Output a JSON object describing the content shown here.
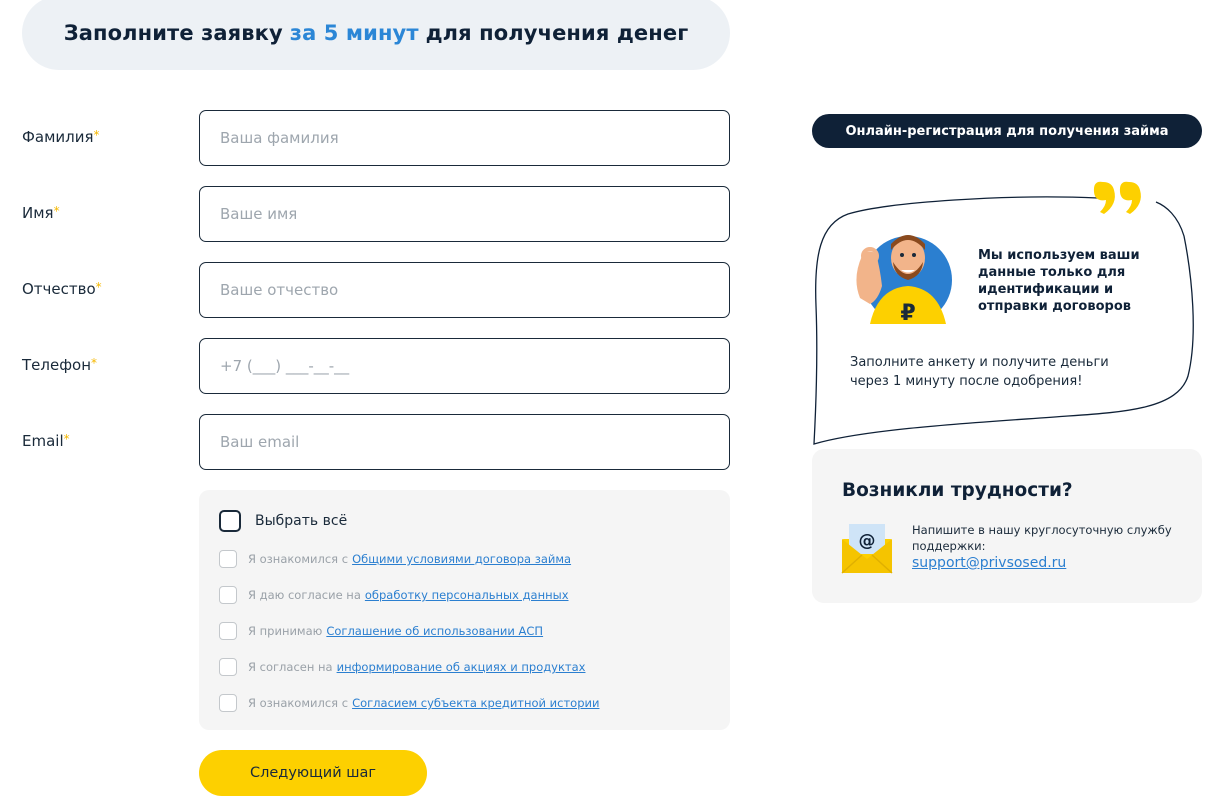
{
  "header": {
    "title_before": "Заполните заявку",
    "title_accent": "за 5 минут",
    "title_after": "для получения денег"
  },
  "form": {
    "fields": [
      {
        "label": "Фамилия",
        "placeholder": "Ваша фамилия"
      },
      {
        "label": "Имя",
        "placeholder": "Ваше имя"
      },
      {
        "label": "Отчество",
        "placeholder": "Ваше отчество"
      },
      {
        "label": "Телефон",
        "placeholder": "+7 (___) ___-__-__"
      },
      {
        "label": "Email",
        "placeholder": "Ваш email"
      }
    ],
    "required_mark": "*"
  },
  "consents": {
    "select_all_label": "Выбрать всё",
    "items": [
      {
        "text": "Я ознакомился с",
        "link": "Общими условиями договора займа"
      },
      {
        "text": "Я даю согласие на",
        "link": "обработку персональных данных"
      },
      {
        "text": "Я принимаю",
        "link": "Соглашение об использовании АСП"
      },
      {
        "text": "Я согласен на",
        "link": "информирование об акциях и продуктах"
      },
      {
        "text": "Я ознакомился с",
        "link": "Согласием субъекта кредитной истории"
      }
    ]
  },
  "next_button": "Следующий шаг",
  "sidebar": {
    "registration_pill": "Онлайн-регистрация для получения займа",
    "bubble_bold": "Мы используем ваши данные только для идентификации и отправки договоров",
    "bubble_text": "Заполните анкету и получите деньги через 1 минуту после одобрения!",
    "help_title": "Возникли трудности?",
    "help_text": "Напишите в нашу круглосуточную службу поддержки:",
    "help_email": "support@privsosed.ru"
  },
  "colors": {
    "accent_blue": "#2b86d6",
    "navy": "#0f2137",
    "yellow": "#fdd000",
    "required_star": "#f5b800"
  }
}
